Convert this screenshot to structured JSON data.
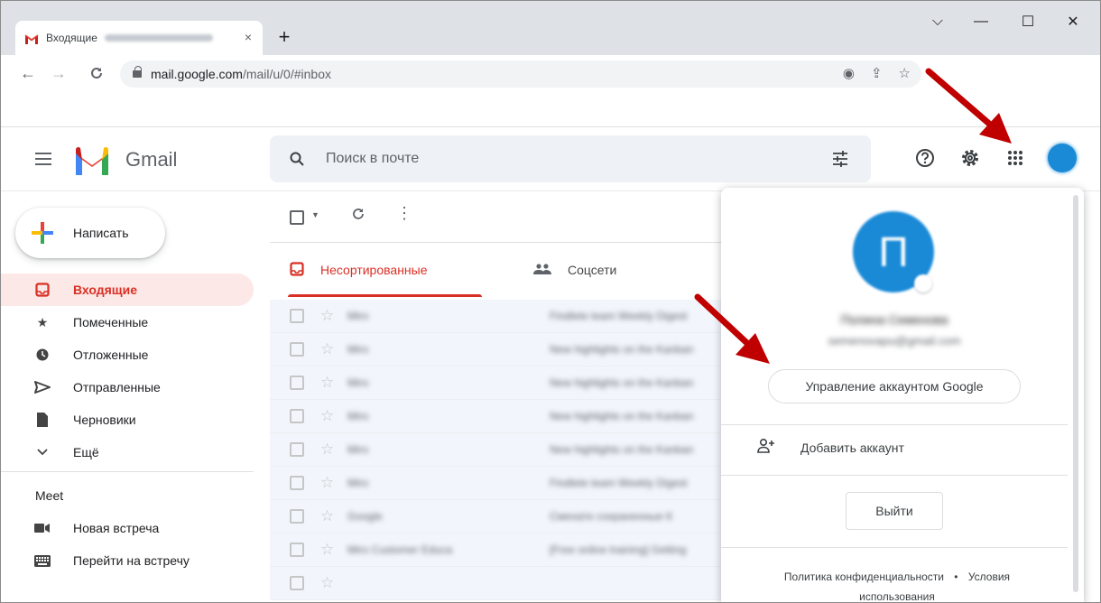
{
  "browser": {
    "tab_title": "Входящие",
    "tab_close": "×",
    "new_tab": "+",
    "url_host": "mail.google.com",
    "url_path": "/mail/u/0/#inbox",
    "window_controls": {
      "chevron": "⌵",
      "minimize": "—",
      "maximize": "☐",
      "close": "✕"
    }
  },
  "gmail": {
    "logo_text": "Gmail",
    "search_placeholder": "Поиск в почте",
    "compose_label": "Написать",
    "nav": [
      {
        "label": "Входящие",
        "icon": "inbox-icon"
      },
      {
        "label": "Помеченные",
        "icon": "star-icon"
      },
      {
        "label": "Отложенные",
        "icon": "clock-icon"
      },
      {
        "label": "Отправленные",
        "icon": "send-icon"
      },
      {
        "label": "Черновики",
        "icon": "draft-icon"
      },
      {
        "label": "Ещё",
        "icon": "chevron-down-icon"
      }
    ],
    "meet": {
      "title": "Meet",
      "items": [
        {
          "label": "Новая встреча",
          "icon": "video-icon"
        },
        {
          "label": "Перейти на встречу",
          "icon": "keyboard-icon"
        }
      ]
    },
    "tabs": [
      {
        "label": "Несортированные"
      },
      {
        "label": "Соцсети"
      }
    ],
    "emails": [
      {
        "sender": "Miro",
        "subject": "Findlete team Weekly Digest"
      },
      {
        "sender": "Miro",
        "subject": "New highlights on the Kanban"
      },
      {
        "sender": "Miro",
        "subject": "New highlights on the Kanban"
      },
      {
        "sender": "Miro",
        "subject": "New highlights on the Kanban"
      },
      {
        "sender": "Miro",
        "subject": "New highlights on the Kanban"
      },
      {
        "sender": "Miro",
        "subject": "Findlete team Weekly Digest"
      },
      {
        "sender": "Google",
        "subject": "Сменате сохраненные К"
      },
      {
        "sender": "Miro Customer Educa",
        "subject": "[Free online training] Getting"
      }
    ]
  },
  "account_popup": {
    "avatar_letter": "П",
    "name": "Полина Семенова",
    "email": "semenovapu@gmail.com",
    "manage_button": "Управление аккаунтом Google",
    "add_account": "Добавить аккаунт",
    "logout": "Выйти",
    "privacy": "Политика конфиденциальности",
    "dot": "•",
    "terms": "Условия использования"
  },
  "colors": {
    "accent_red": "#d93025",
    "annotation_arrow": "#c00000",
    "avatar_blue": "#1a8ad7"
  }
}
